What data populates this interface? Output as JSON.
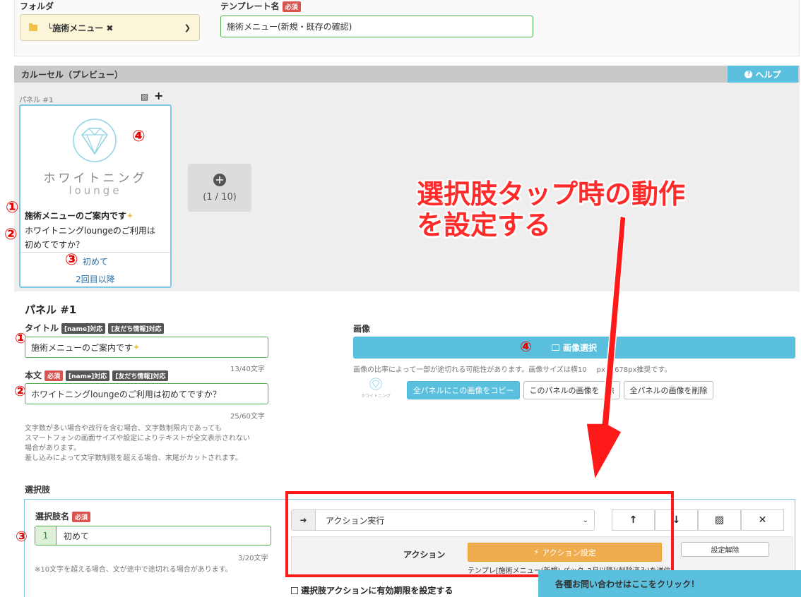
{
  "top": {
    "folder_label": "フォルダ",
    "folder_value": "└施術メニュー ✖",
    "template_label": "テンプレート名",
    "required": "必須",
    "template_value": "施術メニュー(新規・既存の確認)"
  },
  "carousel": {
    "title": "カルーセル（プレビュー）",
    "help": "ヘルプ",
    "panel_label": "パネル #1",
    "add_count": "(1 / 10)"
  },
  "card": {
    "logo_text": "ホワイトニング",
    "logo_sub": "lounge",
    "title": "施術メニューのご案内です",
    "body_line1": "ホワイトニングloungeのご利用は",
    "body_line2": "初めてですか？",
    "choice1": "初めて",
    "choice2": "2回目以降"
  },
  "markers": {
    "one": "①",
    "two": "②",
    "three": "③",
    "four": "④"
  },
  "annotation": {
    "line1": "選択肢タップ時の動作",
    "line2": "を設定する"
  },
  "panel": {
    "heading": "パネル #1",
    "title_label": "タイトル",
    "tag_name": "[name]対応",
    "tag_friend": "[友だち情報]対応",
    "title_value": "施術メニューのご案内です",
    "title_count": "13/40文字",
    "body_label": "本文",
    "body_value": "ホワイトニングloungeのご利用は初めてですか？",
    "body_count": "25/60文字",
    "note1": "文字数が多い場合や改行を含む場合、文字数制限内であっても",
    "note2": "スマートフォンの画面サイズや設定によりテキストが全文表示されない",
    "note3": "場合があります。",
    "note4": "差し込みによって文字数制限を超える場合、末尾がカットされます。",
    "image_label": "画像",
    "image_select": "画像選択",
    "image_note": "画像の比率によって一部が途切れる可能性があります。画像サイズは横10",
    "image_note2": "px 縦678px推奨です。",
    "copy_all": "全パネルにこの画像をコピー",
    "delete_this_a": "このパネルの画像を",
    "delete_this_b": "除",
    "delete_all": "全パネルの画像を削除"
  },
  "choice": {
    "section_label": "選択肢",
    "name_label": "選択肢名",
    "index": "1",
    "value": "初めて",
    "count": "3/20文字",
    "note": "※10文字を超える場合、文が途中で途切れる場合があります。",
    "action_select": "アクション実行",
    "action_label": "アクション",
    "action_set": "アクション設定",
    "action_clear": "設定解除",
    "action_desc": "テンプレ[施術メニュー(新規) パック_2月以降](削除済み)を送信",
    "expiry": "選択肢アクションに有効期限を設定する"
  },
  "contact": "各種お問い合わせはここをクリック！"
}
